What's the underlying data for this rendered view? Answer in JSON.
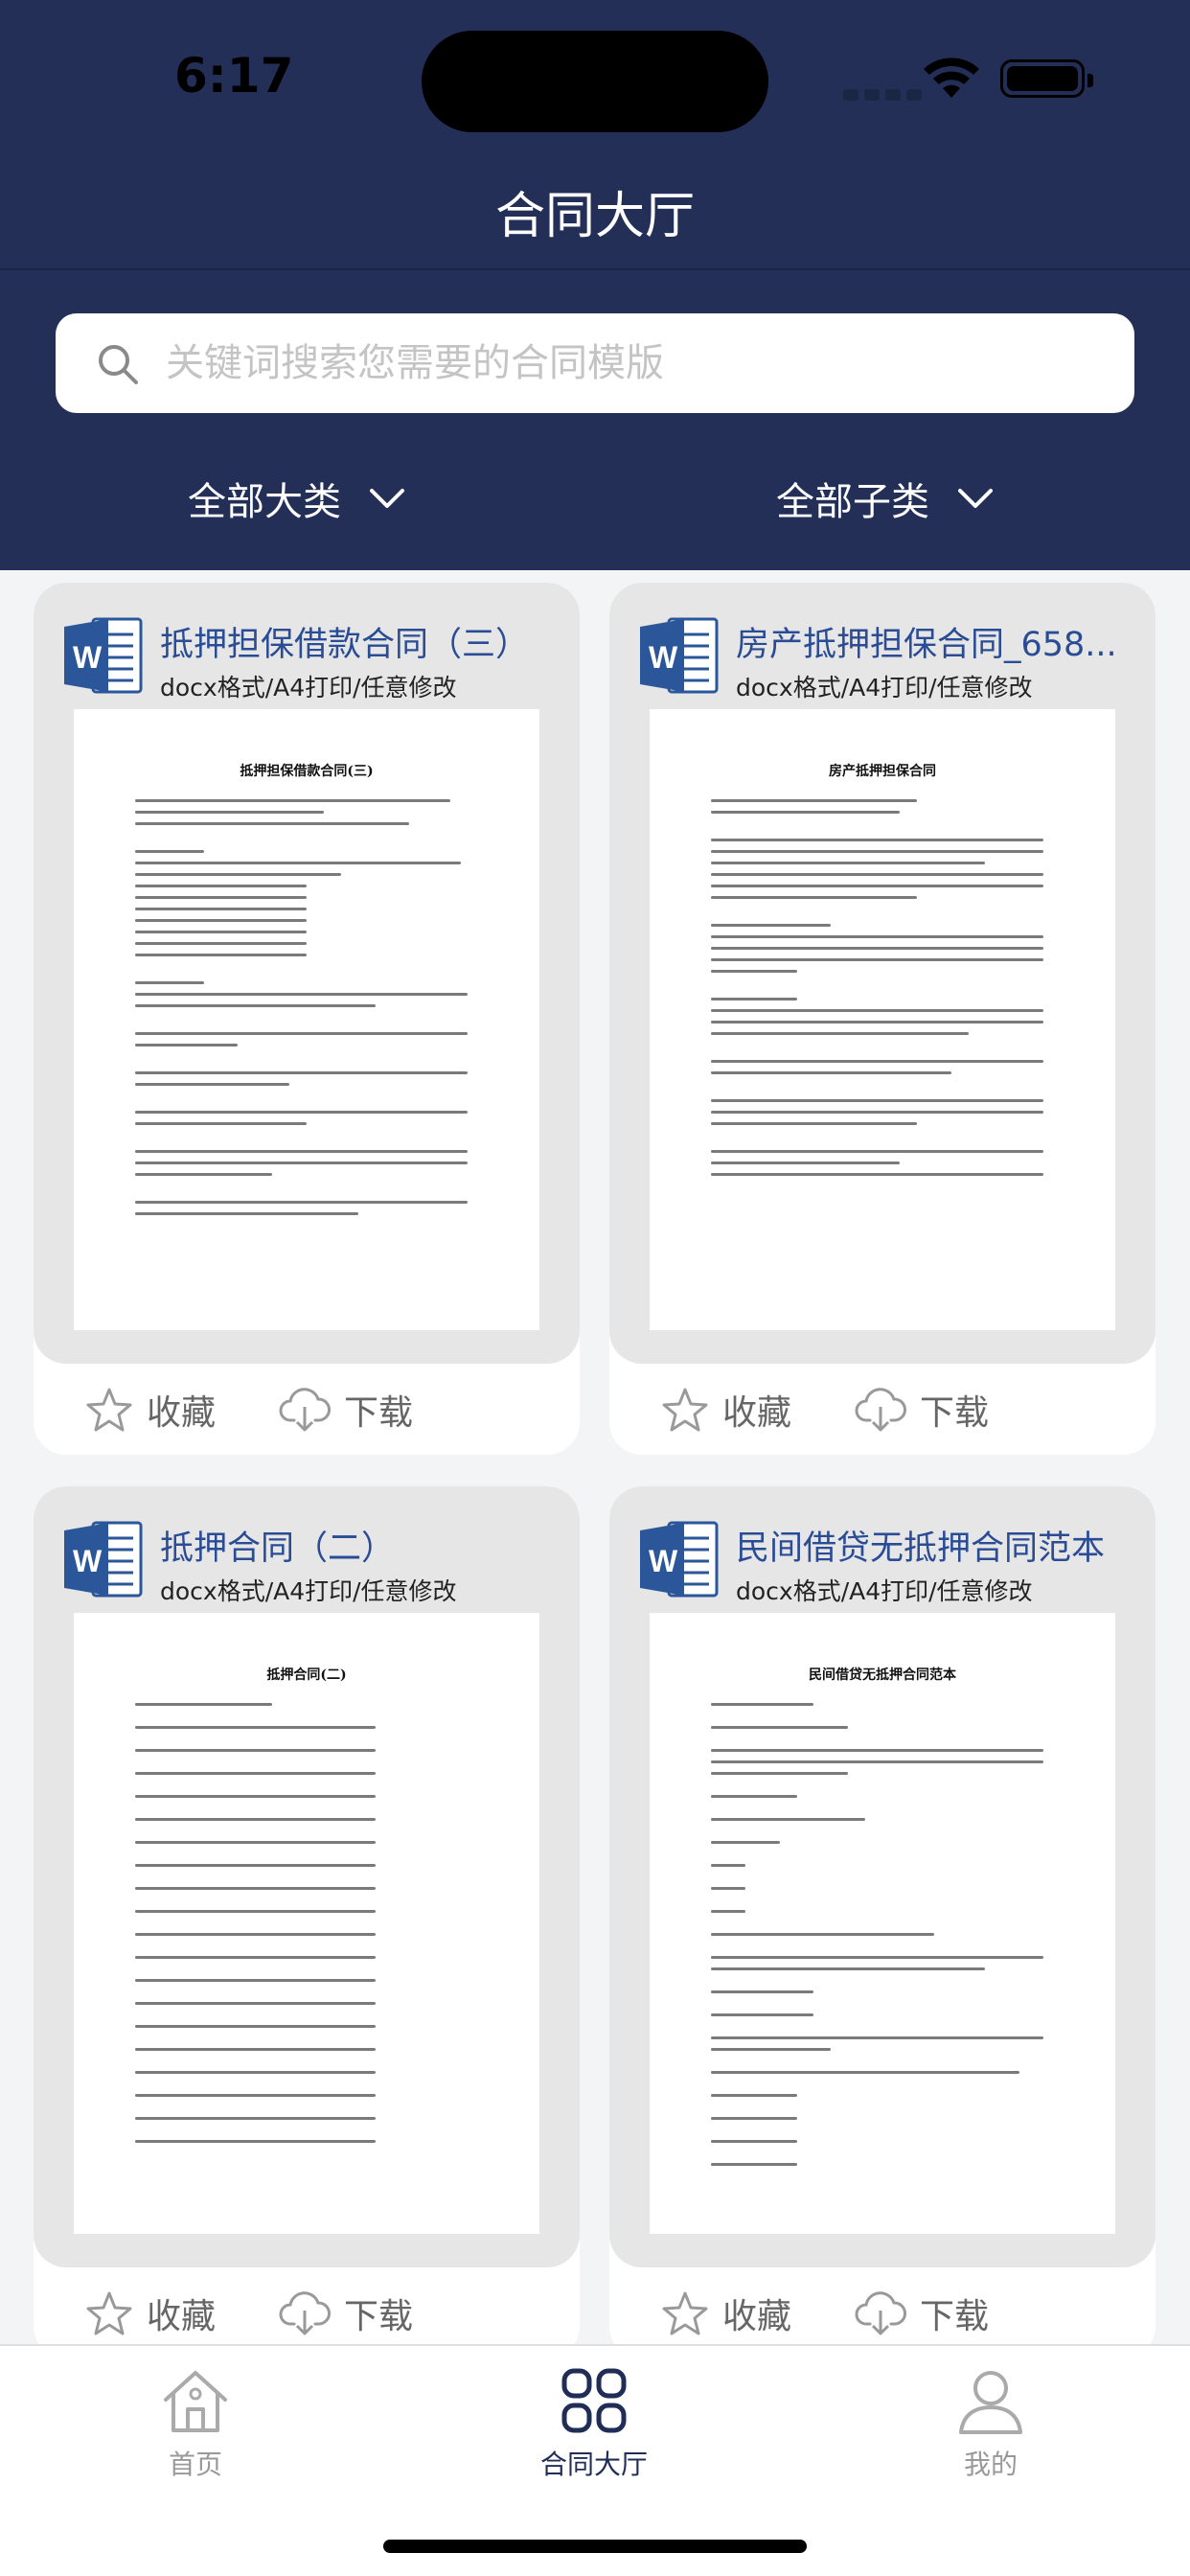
{
  "status_bar": {
    "time": "6:17"
  },
  "header": {
    "title": "合同大厅"
  },
  "search": {
    "placeholder": "关键词搜索您需要的合同模版"
  },
  "filters": {
    "category": "全部大类",
    "subcategory": "全部子类"
  },
  "cards": [
    {
      "title": "抵押担保借款合同（三）",
      "subtitle": "docx格式/A4打印/任意修改",
      "doc_title": "抵押担保借款合同(三)",
      "favorite_label": "收藏",
      "download_label": "下载"
    },
    {
      "title": "房产抵押担保合同_658...",
      "subtitle": "docx格式/A4打印/任意修改",
      "doc_title": "房产抵押担保合同",
      "favorite_label": "收藏",
      "download_label": "下载"
    },
    {
      "title": "抵押合同（二）",
      "subtitle": "docx格式/A4打印/任意修改",
      "doc_title": "抵押合同(二)",
      "favorite_label": "收藏",
      "download_label": "下载"
    },
    {
      "title": "民间借贷无抵押合同范本",
      "subtitle": "docx格式/A4打印/任意修改",
      "doc_title": "民间借贷无抵押合同范本",
      "favorite_label": "收藏",
      "download_label": "下载"
    }
  ],
  "tabbar": {
    "home": "首页",
    "hall": "合同大厅",
    "mine": "我的"
  },
  "colors": {
    "header_bg": "#232f57",
    "title_blue": "#2a4c95",
    "active_tab": "#1f2d57",
    "inactive_tab": "#999999"
  }
}
